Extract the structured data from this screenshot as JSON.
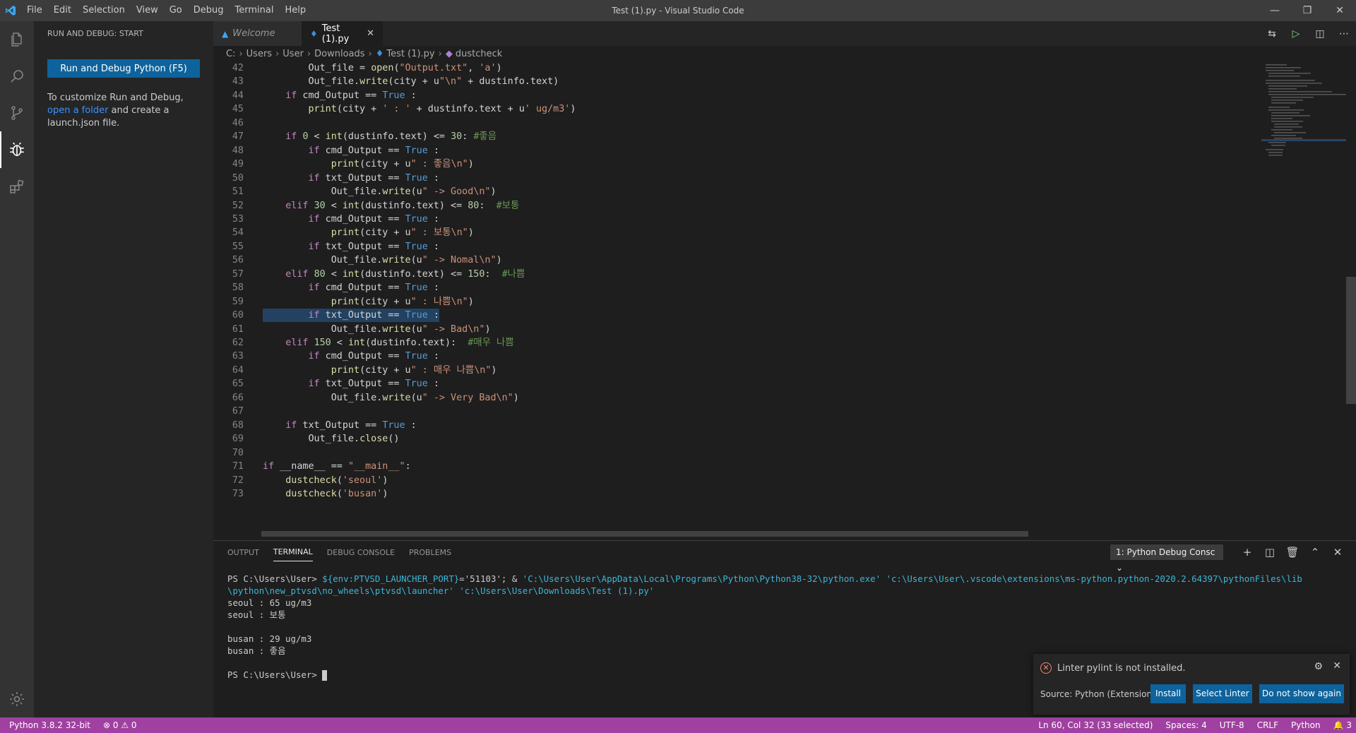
{
  "titlebar": {
    "menu": [
      "File",
      "Edit",
      "Selection",
      "View",
      "Go",
      "Debug",
      "Terminal",
      "Help"
    ],
    "title": "Test (1).py - Visual Studio Code"
  },
  "sidebar": {
    "title": "RUN AND DEBUG: START",
    "run_button": "Run and Debug Python (F5)",
    "hint_prefix": "To customize Run and Debug, ",
    "hint_link": "open a folder",
    "hint_suffix": " and create a launch.json file."
  },
  "tabs": [
    {
      "label": "Welcome",
      "active": false
    },
    {
      "label": "Test (1).py",
      "active": true
    }
  ],
  "breadcrumb": [
    "C:",
    "Users",
    "User",
    "Downloads",
    "Test (1).py",
    "dustcheck"
  ],
  "editor": {
    "lines": [
      {
        "n": "42",
        "code": "        Out_file = open(\"Output.txt\", 'a')"
      },
      {
        "n": "43",
        "code": "        Out_file.write(city + u\"\\n\" + dustinfo.text)"
      },
      {
        "n": "44",
        "code": "    if cmd_Output == True :"
      },
      {
        "n": "45",
        "code": "        print(city + ' : ' + dustinfo.text + u' ug/m3')"
      },
      {
        "n": "46",
        "code": ""
      },
      {
        "n": "47",
        "code": "    if 0 < int(dustinfo.text) <= 30: #좋음"
      },
      {
        "n": "48",
        "code": "        if cmd_Output == True :"
      },
      {
        "n": "49",
        "code": "            print(city + u\" : 좋음\\n\")"
      },
      {
        "n": "50",
        "code": "        if txt_Output == True :"
      },
      {
        "n": "51",
        "code": "            Out_file.write(u\" -> Good\\n\")"
      },
      {
        "n": "52",
        "code": "    elif 30 < int(dustinfo.text) <= 80:  #보통"
      },
      {
        "n": "53",
        "code": "        if cmd_Output == True :"
      },
      {
        "n": "54",
        "code": "            print(city + u\" : 보통\\n\")"
      },
      {
        "n": "55",
        "code": "        if txt_Output == True :"
      },
      {
        "n": "56",
        "code": "            Out_file.write(u\" -> Nomal\\n\")"
      },
      {
        "n": "57",
        "code": "    elif 80 < int(dustinfo.text) <= 150:  #나쁨"
      },
      {
        "n": "58",
        "code": "        if cmd_Output == True :"
      },
      {
        "n": "59",
        "code": "            print(city + u\" : 나쁨\\n\")"
      },
      {
        "n": "60",
        "code": "        if txt_Output == True :"
      },
      {
        "n": "61",
        "code": "            Out_file.write(u\" -> Bad\\n\")"
      },
      {
        "n": "62",
        "code": "    elif 150 < int(dustinfo.text):  #매우 나쁨"
      },
      {
        "n": "63",
        "code": "        if cmd_Output == True :"
      },
      {
        "n": "64",
        "code": "            print(city + u\" : 매우 나쁨\\n\")"
      },
      {
        "n": "65",
        "code": "        if txt_Output == True :"
      },
      {
        "n": "66",
        "code": "            Out_file.write(u\" -> Very Bad\\n\")"
      },
      {
        "n": "67",
        "code": ""
      },
      {
        "n": "68",
        "code": "    if txt_Output == True :"
      },
      {
        "n": "69",
        "code": "        Out_file.close()"
      },
      {
        "n": "70",
        "code": ""
      },
      {
        "n": "71",
        "code": "if __name__ == \"__main__\":"
      },
      {
        "n": "72",
        "code": "    dustcheck('seoul')"
      },
      {
        "n": "73",
        "code": "    dustcheck('busan')"
      }
    ]
  },
  "panel": {
    "tabs": [
      "OUTPUT",
      "TERMINAL",
      "DEBUG CONSOLE",
      "PROBLEMS"
    ],
    "active_tab": "TERMINAL",
    "selector": "1: Python Debug Consc",
    "terminal": {
      "prompt": "PS C:\\Users\\User> ",
      "env_var": "${env:PTVSD_LAUNCHER_PORT}",
      "port": "='51103'; & ",
      "cmd_line1_rest": "'C:\\Users\\User\\AppData\\Local\\Programs\\Python\\Python38-32\\python.exe' 'c:\\Users\\User\\.vscode\\extensions\\ms-python.python-2020.2.64397\\pythonFiles\\lib",
      "cmd_line2": "\\python\\new_ptvsd\\no_wheels\\ptvsd\\launcher' 'c:\\Users\\User\\Downloads\\Test (1).py'",
      "out1": "seoul : 65 ug/m3",
      "out2": "seoul : 보통",
      "out3": "busan : 29 ug/m3",
      "out4": "busan : 좋음",
      "final_prompt": "PS C:\\Users\\User> "
    }
  },
  "notification": {
    "message": "Linter pylint is not installed.",
    "source": "Source: Python (Extension)",
    "buttons": [
      "Install",
      "Select Linter",
      "Do not show again"
    ]
  },
  "statusbar": {
    "python": "Python 3.8.2 32-bit",
    "problems": "⊗ 0 ⚠ 0",
    "position": "Ln 60, Col 32 (33 selected)",
    "spaces": "Spaces: 4",
    "encoding": "UTF-8",
    "eol": "CRLF",
    "language": "Python",
    "notifications": "🔔 3"
  },
  "colors": {
    "statusbar": "#a040a0",
    "accent": "#0e639c",
    "link": "#3794ff"
  }
}
